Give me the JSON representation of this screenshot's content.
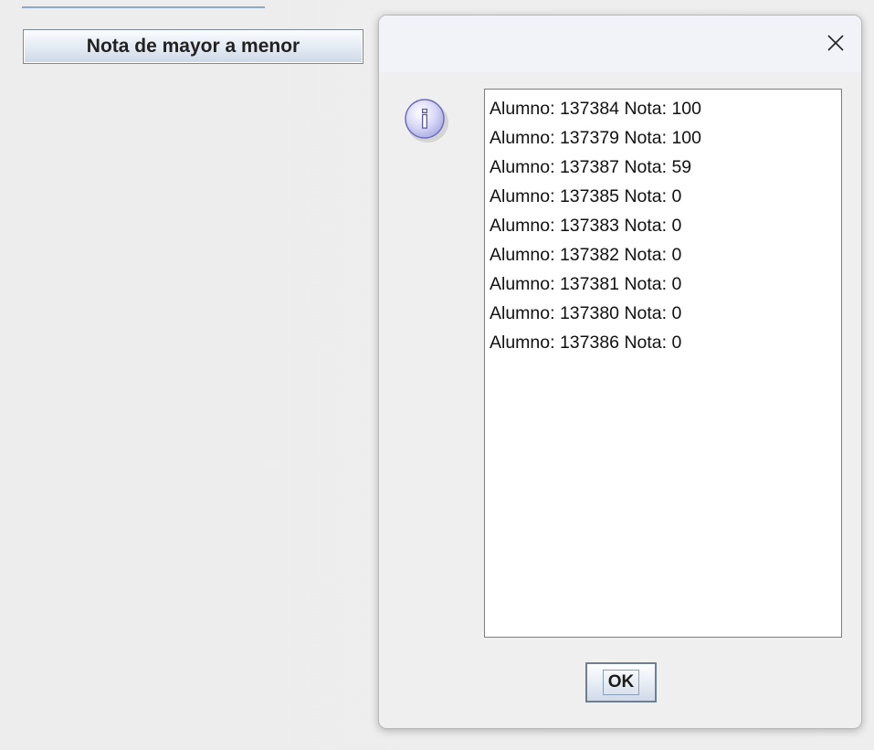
{
  "background_window": {
    "sort_button_label": "Nota de mayor a menor"
  },
  "dialog": {
    "close_symbol": "×",
    "icon": "info-icon",
    "icon_glyph": "i",
    "message_lines": [
      "Alumno: 137384 Nota: 100",
      "Alumno: 137379 Nota: 100",
      "Alumno: 137387 Nota: 59",
      "Alumno: 137385 Nota: 0",
      "Alumno: 137383 Nota: 0",
      "Alumno: 137382 Nota: 0",
      "Alumno: 137381 Nota: 0",
      "Alumno: 137380 Nota: 0",
      "Alumno: 137386 Nota: 0"
    ],
    "ok_label": "OK"
  },
  "colors": {
    "background": "#eeeeee",
    "dialog_titlebar": "#f1f3f9",
    "button_border": "#7a8a99",
    "info_icon_fill": "#c8c8ef"
  }
}
